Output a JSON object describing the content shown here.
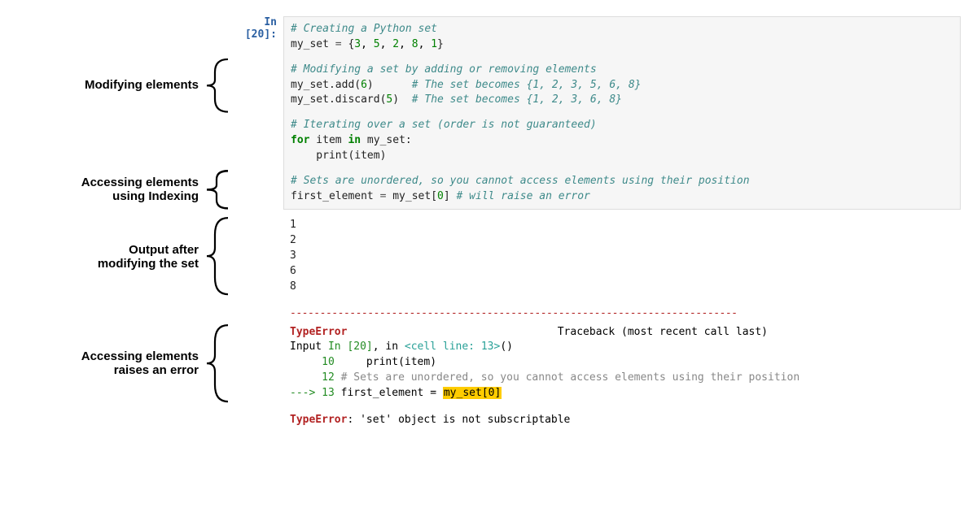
{
  "prompt": "In [20]:",
  "labels": {
    "modify": "Modifying elements",
    "indexing_l1": "Accessing elements",
    "indexing_l2": "using Indexing",
    "output_l1": "Output after",
    "output_l2": "modifying the set",
    "error_l1": "Accessing elements",
    "error_l2": "raises an error"
  },
  "code": {
    "c1": "# Creating a Python set",
    "l2a": "my_set ",
    "l2b": "=",
    "l2c": " {",
    "l2n1": "3",
    "l2n2": "5",
    "l2n3": "2",
    "l2n4": "8",
    "l2n5": "1",
    "l2d": "}",
    "c2": "# Modifying a set by adding or removing elements",
    "l4a": "my_set.add(",
    "l4n": "6",
    "l4b": ")      ",
    "c3": "# The set becomes {1, 2, 3, 5, 6, 8}",
    "l5a": "my_set.discard(",
    "l5n": "5",
    "l5b": ")  ",
    "c4": "# The set becomes {1, 2, 3, 6, 8}",
    "c5": "# Iterating over a set (order is not guaranteed)",
    "l7a": "for",
    "l7b": " item ",
    "l7c": "in",
    "l7d": " my_set:",
    "l8a": "    print(item)",
    "c6": "# Sets are unordered, so you cannot access elements using their position",
    "l10a": "first_element ",
    "l10b": "=",
    "l10c": " my_set[",
    "l10n": "0",
    "l10d": "] ",
    "c7": "# will raise an error"
  },
  "output": {
    "o1": "1",
    "o2": "2",
    "o3": "3",
    "o4": "6",
    "o5": "8"
  },
  "error": {
    "sep": "---------------------------------------------------------------------------",
    "type": "TypeError",
    "traceback": "                                 Traceback (most recent call last)",
    "l2a": "Input ",
    "l2b": "In [20]",
    "l2c": ", in ",
    "l2d": "<cell line: 13>",
    "l2e": "()",
    "l3a": "     ",
    "l3n": "10",
    "l3b": "     print(item)",
    "l4a": "     ",
    "l4n": "12",
    "l4b": " ",
    "l4c": "# Sets are unordered, so you cannot access elements using their position",
    "l5a": "---> ",
    "l5n": "13",
    "l5b": " first_element ",
    "l5c": "=",
    "l5d": " ",
    "l5e": "my_set[",
    "l5f": "0",
    "l5g": "]",
    "final_a": "TypeError",
    "final_b": ": 'set' object is not subscriptable"
  }
}
